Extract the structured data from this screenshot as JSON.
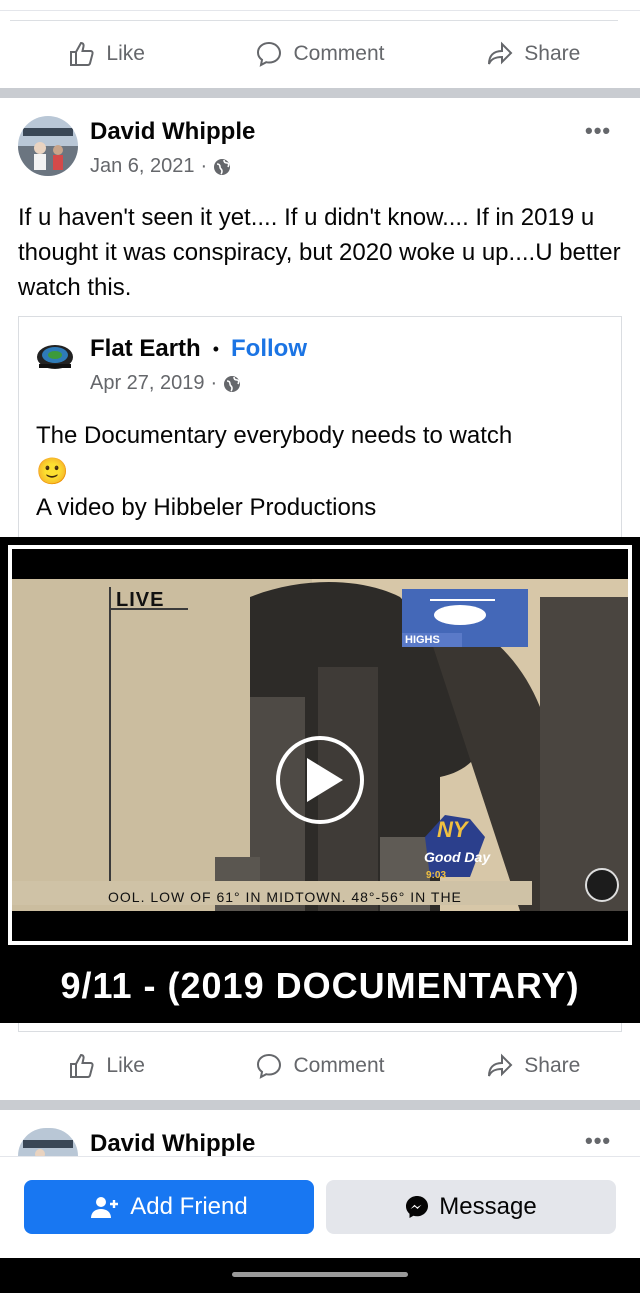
{
  "actions": {
    "like": "Like",
    "comment": "Comment",
    "share": "Share"
  },
  "post": {
    "author": "David Whipple",
    "date": "Jan 6, 2021",
    "separator": "·",
    "text": "If u haven't seen it yet.... If u didn't know.... If in 2019 u thought it was conspiracy, but 2020 woke u up....U better watch this.",
    "more": "•••"
  },
  "shared": {
    "page_name": "Flat Earth",
    "dot": "•",
    "follow": "Follow",
    "date": "Apr 27, 2019",
    "separator": "·",
    "text_line1": "The Documentary everybody needs to watch",
    "emoji": "🙂",
    "text_line2": "A video by Hibbeler Productions"
  },
  "video": {
    "live_label": "LIVE",
    "highs_label": "HIGHS",
    "ny_label": "NY",
    "goodday_label": "Good Day",
    "time_label": "9:03",
    "ticker": "OOL. LOW OF 61° IN MIDTOWN. 48°-56° IN THE",
    "caption": "9/11 - (2019 DOCUMENTARY)"
  },
  "next_post": {
    "author": "David Whipple",
    "more": "•••"
  },
  "bottom_bar": {
    "add_friend": "Add Friend",
    "message": "Message"
  },
  "colors": {
    "accent": "#1877f2",
    "follow": "#1b74e4",
    "secondary": "#65676b"
  }
}
